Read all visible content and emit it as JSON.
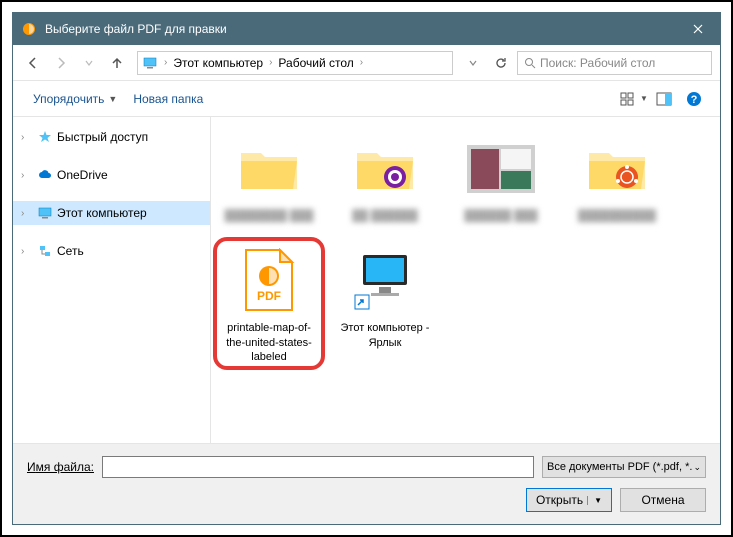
{
  "titlebar": {
    "title": "Выберите файл PDF для правки"
  },
  "breadcrumb": {
    "items": [
      "Этот компьютер",
      "Рабочий стол"
    ]
  },
  "search": {
    "placeholder": "Поиск: Рабочий стол"
  },
  "toolbar": {
    "organize": "Упорядочить",
    "new_folder": "Новая папка"
  },
  "sidebar": {
    "items": [
      {
        "label": "Быстрый доступ",
        "icon": "star"
      },
      {
        "label": "OneDrive",
        "icon": "cloud"
      },
      {
        "label": "Этот компьютер",
        "icon": "pc",
        "selected": true
      },
      {
        "label": "Сеть",
        "icon": "network"
      }
    ]
  },
  "files": {
    "row1": [
      {
        "label": "blurred",
        "type": "folder"
      },
      {
        "label": "blurred",
        "type": "folder-tor"
      },
      {
        "label": "blurred",
        "type": "image"
      },
      {
        "label": "blurred",
        "type": "folder-ubuntu"
      }
    ],
    "pdf": {
      "label": "printable-map-of-the-united-states-labeled"
    },
    "pc_shortcut": {
      "label": "Этот компьютер - Ярлык"
    }
  },
  "bottom": {
    "filename_label": "Имя файла:",
    "filename_value": "",
    "filetype": "Все документы PDF (*.pdf, *.pc",
    "open": "Открыть",
    "cancel": "Отмена"
  }
}
